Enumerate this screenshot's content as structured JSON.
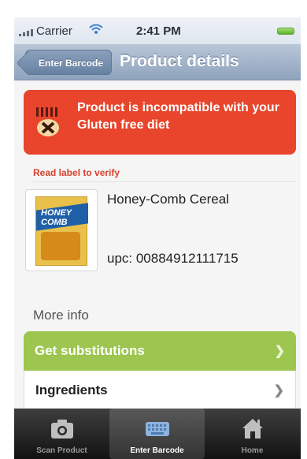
{
  "status": {
    "carrier": "Carrier",
    "time": "2:41 PM"
  },
  "nav": {
    "back_label": "Enter Barcode",
    "title": "Product details"
  },
  "alert": {
    "message": "Product is incompatible with your Gluten free diet",
    "color": "#e8452c"
  },
  "verify_text": "Read label to verify",
  "product": {
    "name": "Honey-Comb Cereal",
    "upc": "upc: 00884912111715",
    "box_text": "HONEY COMB"
  },
  "more_info": {
    "heading": "More info",
    "items": [
      {
        "label": "Get substitutions",
        "color": "#9cc64f"
      },
      {
        "label": "Ingredients"
      }
    ]
  },
  "tabs": [
    {
      "label": "Scan Product",
      "icon": "camera-icon"
    },
    {
      "label": "Enter Barcode",
      "icon": "keyboard-icon",
      "active": true
    },
    {
      "label": "Home",
      "icon": "home-icon"
    }
  ]
}
